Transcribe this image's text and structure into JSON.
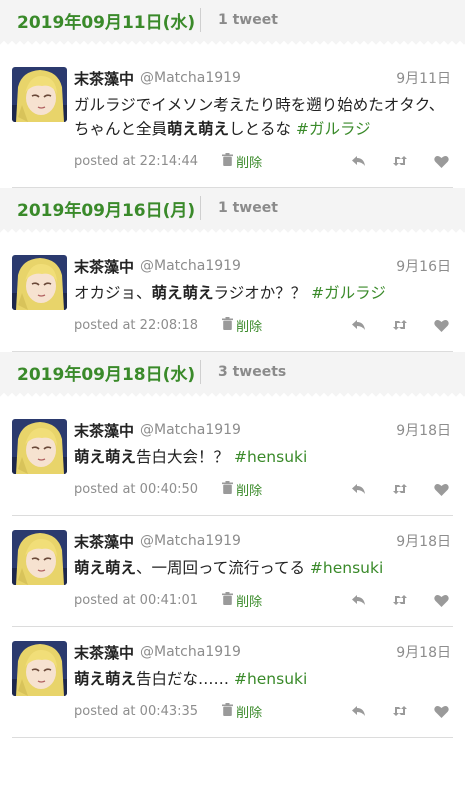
{
  "user": {
    "name": "末茶藻中",
    "handle": "@Matcha1919"
  },
  "posted_prefix": "posted at",
  "delete_label": "削除",
  "days": [
    {
      "date": "2019年09月11日(水)",
      "count": "1 tweet",
      "tweets": [
        {
          "date": "9月11日",
          "time": "22:14:44",
          "parts": [
            {
              "t": "ガルラジでイメソン考えたり時を遡り始めたオタク、ちゃんと全員"
            },
            {
              "t": "萌え萌え",
              "b": true
            },
            {
              "t": "しとるな "
            },
            {
              "t": "#ガルラジ",
              "tag": true
            }
          ]
        }
      ]
    },
    {
      "date": "2019年09月16日(月)",
      "count": "1 tweet",
      "tweets": [
        {
          "date": "9月16日",
          "time": "22:08:18",
          "parts": [
            {
              "t": "オカジョ、"
            },
            {
              "t": "萌え萌え",
              "b": true
            },
            {
              "t": "ラジオか？？ "
            },
            {
              "t": "#ガルラジ",
              "tag": true
            }
          ]
        }
      ]
    },
    {
      "date": "2019年09月18日(水)",
      "count": "3 tweets",
      "tweets": [
        {
          "date": "9月18日",
          "time": "00:40:50",
          "parts": [
            {
              "t": "萌え萌え",
              "b": true
            },
            {
              "t": "告白大会！？ "
            },
            {
              "t": "#hensuki",
              "tag": true
            }
          ]
        },
        {
          "date": "9月18日",
          "time": "00:41:01",
          "parts": [
            {
              "t": "萌え萌え",
              "b": true
            },
            {
              "t": "、一周回って流行ってる "
            },
            {
              "t": "#hensuki",
              "tag": true
            }
          ]
        },
        {
          "date": "9月18日",
          "time": "00:43:35",
          "parts": [
            {
              "t": "萌え萌え",
              "b": true
            },
            {
              "t": "告白だな…… "
            },
            {
              "t": "#hensuki",
              "tag": true
            }
          ]
        }
      ]
    }
  ]
}
